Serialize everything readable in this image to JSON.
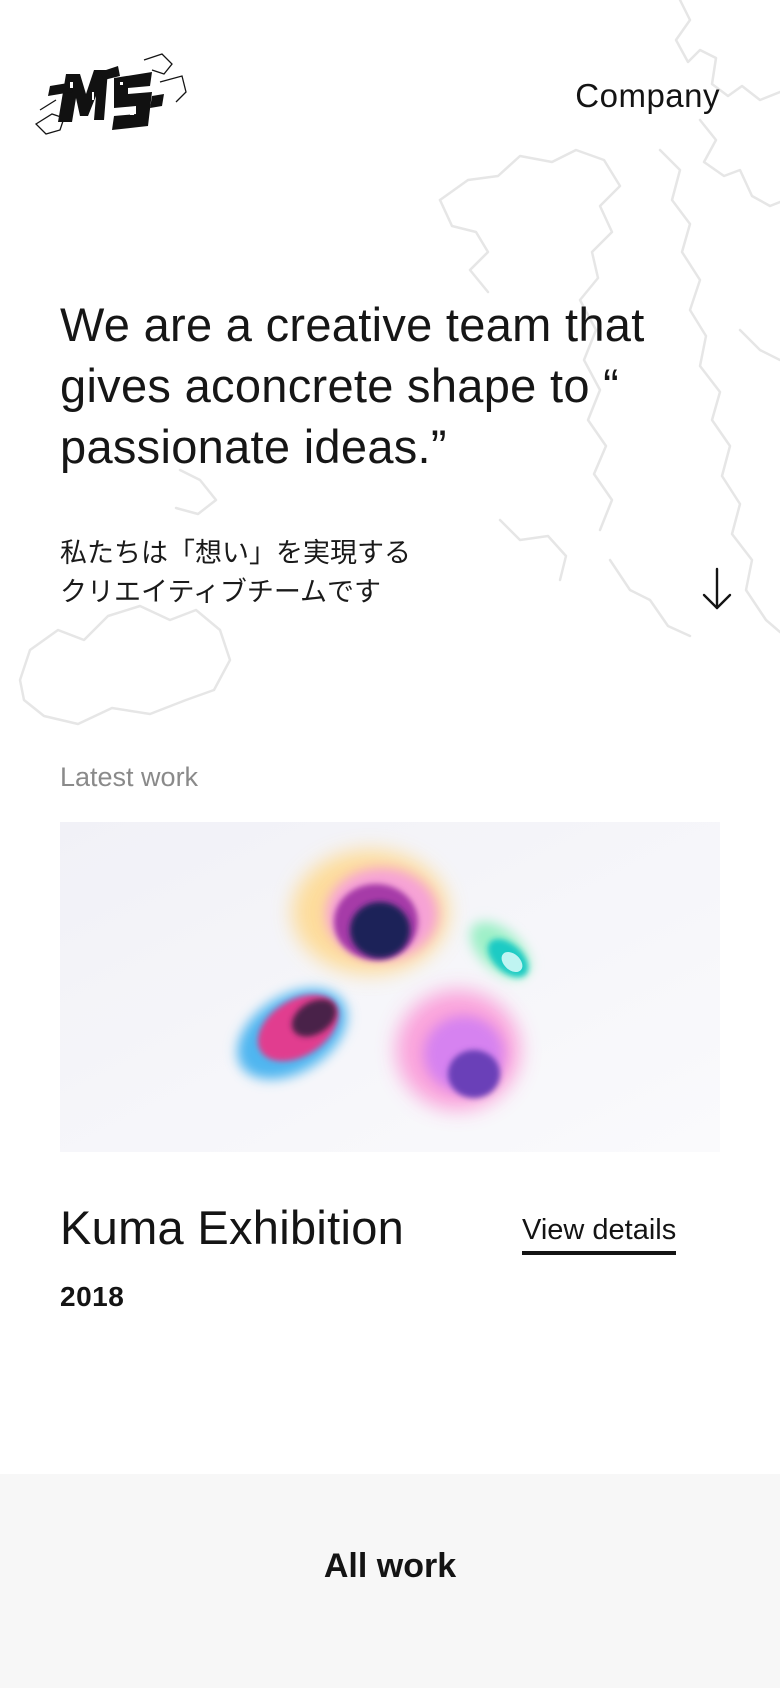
{
  "header": {
    "logo_text": "MS",
    "nav_company": "Company"
  },
  "hero": {
    "headline_line1": "We are a creative team that",
    "headline_line2": "gives aconcrete shape to “",
    "headline_line3": "passionate ideas.”",
    "subhead_line1": "私たちは「想い」を実現する",
    "subhead_line2": "クリエイティブチームです",
    "scroll_icon": "arrow-down-icon"
  },
  "latest": {
    "label": "Latest work",
    "title": "Kuma Exhibition",
    "year": "2018",
    "view_details": "View details"
  },
  "footer": {
    "all_work": "All work"
  },
  "colors": {
    "text": "#141414",
    "muted": "#8a8a8a",
    "map_line": "#e6e6e6",
    "footer_bg": "#f7f7f7",
    "image_bg": "#f4f4f8"
  }
}
